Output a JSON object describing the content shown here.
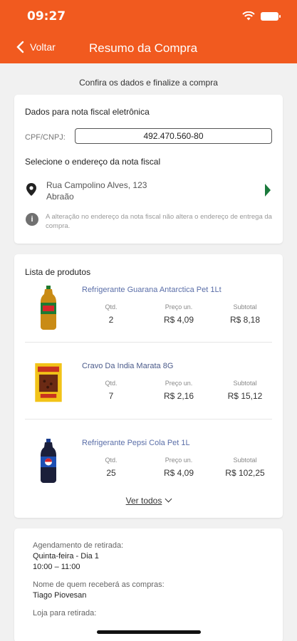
{
  "status": {
    "time": "09:27"
  },
  "header": {
    "back_label": "Voltar",
    "title": "Resumo da Compra"
  },
  "subtitle": "Confira os dados e finalize a compra",
  "invoice": {
    "section_title": "Dados para nota fiscal eletrônica",
    "cpf_label": "CPF/CNPJ:",
    "cpf_value": "492.470.560-80",
    "address_title": "Selecione o endereço da nota fiscal",
    "address_line1": "Rua Campolino Alves, 123",
    "address_line2": "Abraão",
    "info_text": "A alteração no endereço da nota fiscal não altera o endereço de entrega da compra."
  },
  "products": {
    "section_title": "Lista de produtos",
    "qty_label": "Qtd.",
    "unit_label": "Preço un.",
    "subtotal_label": "Subtotal",
    "items": [
      {
        "name": "Refrigerante Guarana Antarctica Pet 1Lt",
        "qty": "2",
        "unit_price": "R$ 4,09",
        "subtotal": "R$ 8,18"
      },
      {
        "name": "Cravo Da India Marata 8G",
        "qty": "7",
        "unit_price": "R$ 2,16",
        "subtotal": "R$ 15,12"
      },
      {
        "name": "Refrigerante Pepsi Cola Pet 1L",
        "qty": "25",
        "unit_price": "R$ 4,09",
        "subtotal": "R$ 102,25"
      }
    ],
    "see_all_label": "Ver todos"
  },
  "pickup": {
    "schedule_label": "Agendamento de retirada:",
    "schedule_day": "Quinta-feira - Dia 1",
    "schedule_time": "10:00 – 11:00",
    "receiver_label": "Nome de quem receberá as compras:",
    "receiver_name": "Tiago Piovesan",
    "store_label": "Loja para retirada:"
  },
  "colors": {
    "header": "#f15a1f",
    "link": "#5a6ea8",
    "arrow": "#1b7a3c"
  }
}
